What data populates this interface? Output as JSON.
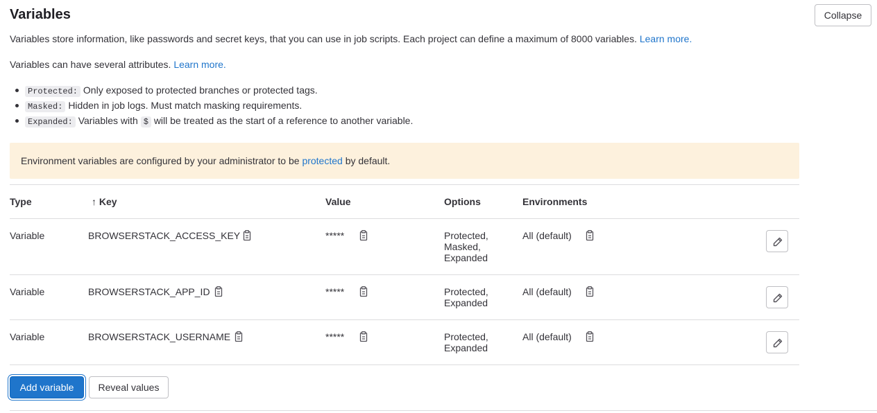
{
  "section": {
    "title": "Variables",
    "collapse_label": "Collapse",
    "description": "Variables store information, like passwords and secret keys, that you can use in job scripts. Each project can define a maximum of 8000 variables.",
    "description_link": "Learn more.",
    "attributes_intro": "Variables can have several attributes.",
    "attributes_link": "Learn more.",
    "attributes": [
      {
        "tag": "Protected:",
        "text": "Only exposed to protected branches or protected tags."
      },
      {
        "tag": "Masked:",
        "text": "Hidden in job logs. Must match masking requirements."
      },
      {
        "tag": "Expanded:",
        "text_before": "Variables with",
        "code": "$",
        "text_after": "will be treated as the start of a reference to another variable."
      }
    ]
  },
  "alert": {
    "text_before": "Environment variables are configured by your administrator to be",
    "link": "protected",
    "text_after": "by default."
  },
  "table": {
    "headers": {
      "type": "Type",
      "key_arrow": "↑",
      "key": "Key",
      "value": "Value",
      "options": "Options",
      "environments": "Environments"
    },
    "rows": [
      {
        "type": "Variable",
        "key": "BROWSERSTACK_ACCESS_KEY",
        "value": "*****",
        "options": [
          "Protected,",
          "Masked,",
          "Expanded"
        ],
        "environment": "All (default)"
      },
      {
        "type": "Variable",
        "key": "BROWSERSTACK_APP_ID",
        "value": "*****",
        "options": [
          "Protected,",
          "Expanded"
        ],
        "environment": "All (default)"
      },
      {
        "type": "Variable",
        "key": "BROWSERSTACK_USERNAME",
        "value": "*****",
        "options": [
          "Protected,",
          "Expanded"
        ],
        "environment": "All (default)"
      }
    ]
  },
  "actions": {
    "add_label": "Add variable",
    "reveal_label": "Reveal values"
  },
  "icons": {
    "copy": "copy-to-clipboard-icon",
    "edit": "pencil-icon"
  },
  "colors": {
    "link": "#1f75cb",
    "primary_button": "#1f75cb",
    "alert_background": "#fdf1dd"
  }
}
